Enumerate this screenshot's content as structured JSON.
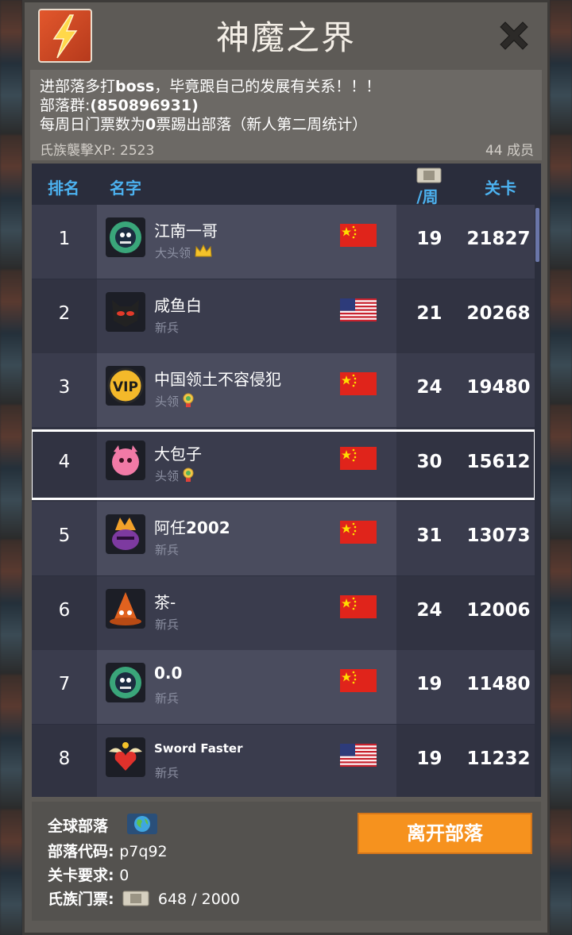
{
  "title": "神魔之界",
  "notice": {
    "line1": "进部落多打boss，毕竟跟自己的发展有关系！！！",
    "line2_label": "部落群:",
    "line2_value": "(850896931)",
    "line3": "每周日门票数为0票踢出部落（新人第二周统计）"
  },
  "clan_xp": "氏族襲擊XP: 2523",
  "members": "44 成员",
  "table": {
    "headers": {
      "rank": "排名",
      "name": "名字",
      "week": "/周",
      "stage": "关卡"
    },
    "rows": [
      {
        "rank": "1",
        "name": "江南一哥",
        "role": "大头领",
        "badge": "crown-icon",
        "country": "CN",
        "week": "19",
        "stage": "21827",
        "avatar": "gear-monster-avatar"
      },
      {
        "rank": "2",
        "name": "咸鱼白",
        "role": "新兵",
        "badge": "",
        "country": "US",
        "week": "21",
        "stage": "20268",
        "avatar": "black-cat-avatar"
      },
      {
        "rank": "3",
        "name": "中国领土不容侵犯",
        "role": "头领",
        "badge": "medal-icon",
        "country": "CN",
        "week": "24",
        "stage": "19480",
        "avatar": "vip-avatar"
      },
      {
        "rank": "4",
        "name": "大包子",
        "role": "头领",
        "badge": "medal-icon",
        "country": "CN",
        "week": "30",
        "stage": "15612",
        "avatar": "pink-monster-avatar"
      },
      {
        "rank": "5",
        "name": "阿任2002",
        "role": "新兵",
        "badge": "",
        "country": "CN",
        "week": "31",
        "stage": "13073",
        "avatar": "purple-hero-avatar"
      },
      {
        "rank": "6",
        "name": "茶-",
        "role": "新兵",
        "badge": "",
        "country": "CN",
        "week": "24",
        "stage": "12006",
        "avatar": "wizard-hat-avatar"
      },
      {
        "rank": "7",
        "name": "0.0",
        "role": "新兵",
        "badge": "",
        "country": "CN",
        "week": "19",
        "stage": "11480",
        "avatar": "gear-monster-avatar"
      },
      {
        "rank": "8",
        "name": "Sword Faster",
        "role": "新兵",
        "badge": "",
        "country": "US",
        "week": "19",
        "stage": "11232",
        "avatar": "winged-heart-avatar"
      }
    ],
    "selected_rank": 4
  },
  "footer": {
    "global_label": "全球部落",
    "code_label": "部落代码:",
    "code_value": "p7q92",
    "stage_req_label": "关卡要求:",
    "stage_req_value": "0",
    "tickets_label": "氏族门票:",
    "tickets_value": "648 / 2000",
    "leave_button": "离开部落"
  },
  "colors": {
    "header_text": "#4cb2f0",
    "row_light": "#4a4c5e",
    "row_dark": "#3a3c4d",
    "leave_button": "#f6921e"
  }
}
